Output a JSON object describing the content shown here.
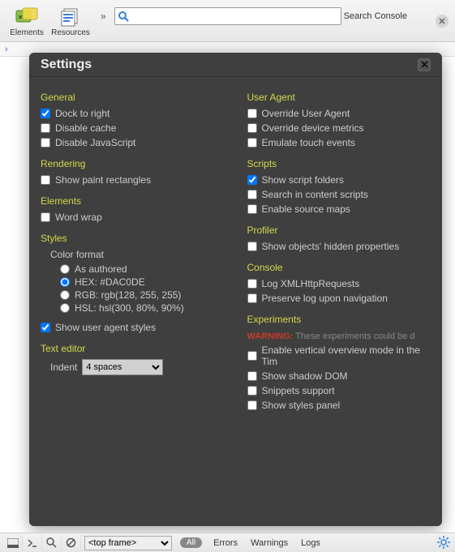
{
  "toolbar": {
    "elements_label": "Elements",
    "resources_label": "Resources",
    "chevron": "»",
    "search_placeholder": "",
    "search_label": "Search Console"
  },
  "crumb": {
    "chevron": "›"
  },
  "settings": {
    "title": "Settings",
    "left": {
      "general": {
        "title": "General",
        "dock_to_right": "Dock to right",
        "disable_cache": "Disable cache",
        "disable_js": "Disable JavaScript"
      },
      "rendering": {
        "title": "Rendering",
        "show_paint": "Show paint rectangles"
      },
      "elements": {
        "title": "Elements",
        "word_wrap": "Word wrap"
      },
      "styles": {
        "title": "Styles",
        "color_format": "Color format",
        "as_authored": "As authored",
        "hex": "HEX: #DAC0DE",
        "rgb": "RGB: rgb(128, 255, 255)",
        "hsl": "HSL: hsl(300, 80%, 90%)",
        "show_ua": "Show user agent styles"
      },
      "text_editor": {
        "title": "Text editor",
        "indent_label": "Indent",
        "indent_value": "4 spaces"
      }
    },
    "right": {
      "user_agent": {
        "title": "User Agent",
        "override_ua": "Override User Agent",
        "override_metrics": "Override device metrics",
        "emulate_touch": "Emulate touch events"
      },
      "scripts": {
        "title": "Scripts",
        "show_folders": "Show script folders",
        "search_content": "Search in content scripts",
        "enable_maps": "Enable source maps"
      },
      "profiler": {
        "title": "Profiler",
        "show_hidden": "Show objects' hidden properties"
      },
      "console": {
        "title": "Console",
        "log_xhr": "Log XMLHttpRequests",
        "preserve_log": "Preserve log upon navigation"
      },
      "experiments": {
        "title": "Experiments",
        "warning_label": "WARNING:",
        "warning_text": " These experiments could be d",
        "vertical_overview": "Enable vertical overview mode in the Tim",
        "shadow_dom": "Show shadow DOM",
        "snippets": "Snippets support",
        "styles_panel": "Show styles panel"
      }
    }
  },
  "bottom": {
    "frame": "<top frame>",
    "all": "All",
    "errors": "Errors",
    "warnings": "Warnings",
    "logs": "Logs"
  }
}
